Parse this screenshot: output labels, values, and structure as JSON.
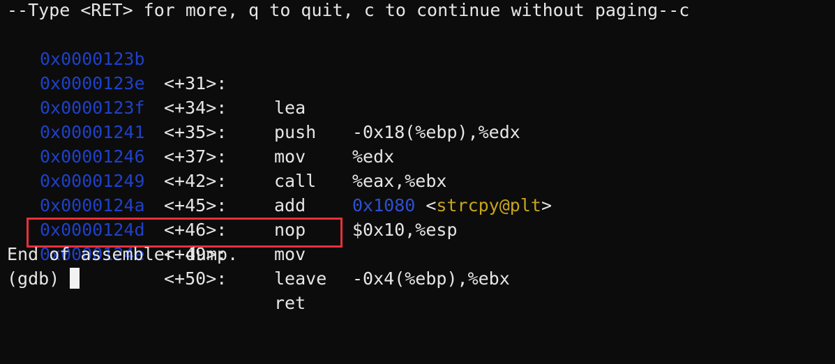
{
  "terminal": {
    "pager_prompt": "--Type <RET> for more, q to quit, c to continue without paging--c",
    "rows": [
      {
        "addr": "0x0000123b",
        "offset": "<+31>:",
        "mnemonic": "lea",
        "operands": "-0x18(%ebp),%edx"
      },
      {
        "addr": "0x0000123e",
        "offset": "<+34>:",
        "mnemonic": "push",
        "operands": "%edx"
      },
      {
        "addr": "0x0000123f",
        "offset": "<+35>:",
        "mnemonic": "mov",
        "operands": "%eax,%ebx"
      },
      {
        "addr": "0x00001241",
        "offset": "<+37>:",
        "mnemonic": "call",
        "operands": "",
        "target_addr": "0x1080",
        "target_sym_open": " <",
        "target_sym": "strcpy@plt",
        "target_sym_close": ">"
      },
      {
        "addr": "0x00001246",
        "offset": "<+42>:",
        "mnemonic": "add",
        "operands": "$0x10,%esp"
      },
      {
        "addr": "0x00001249",
        "offset": "<+45>:",
        "mnemonic": "nop",
        "operands": ""
      },
      {
        "addr": "0x0000124a",
        "offset": "<+46>:",
        "mnemonic": "mov",
        "operands": "-0x4(%ebp),%ebx"
      },
      {
        "addr": "0x0000124d",
        "offset": "<+49>:",
        "mnemonic": "leave",
        "operands": ""
      },
      {
        "addr": "0x0000124e",
        "offset": "<+50>:",
        "mnemonic": "ret",
        "operands": ""
      }
    ],
    "end_message": "End of assembler dump.",
    "prompt": "(gdb) "
  },
  "colors": {
    "background": "#0c0c0c",
    "text": "#e6e6e6",
    "address": "#1f41c9",
    "symbol": "#c8a51d",
    "highlight": "#e8313a"
  }
}
